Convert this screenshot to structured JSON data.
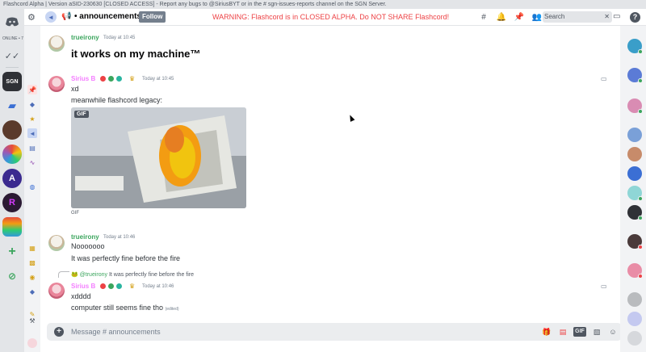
{
  "window": {
    "title": "Flashcord Alpha | Version aSID-230630 [CLOSED ACCESS] - Report any bugs to @SiriusBYT or in the # sgn-issues-reports channel on the SGN Server."
  },
  "server_rail": {
    "online_label": "ONLINE • 7"
  },
  "topbar": {
    "channel_name": "announcements",
    "follow_label": "Follow",
    "warning": "WARNING: Flashcord is in CLOSED ALPHA. Do NOT SHARE Flashcord!",
    "search_placeholder": "Search"
  },
  "messages": [
    {
      "author": "trueirony",
      "timestamp": "Today at 10:45",
      "text": "it works on my machine™"
    },
    {
      "author": "Sirius B",
      "timestamp": "Today at 10:45",
      "lines": [
        "xd",
        "meanwhile flashcord legacy:"
      ],
      "gif_tag": "GIF",
      "gif_caption": "GIF"
    },
    {
      "author": "trueirony",
      "timestamp": "Today at 10:46",
      "lines": [
        "Nooooooo",
        "It was perfectly fine before the fire"
      ]
    },
    {
      "reply_to": "@trueirony",
      "reply_excerpt": "It was perfectly fine before the fire",
      "author": "Sirius B",
      "timestamp": "Today at 10:46",
      "lines": [
        "xdddd",
        "computer still seems fine tho"
      ],
      "edited_label": "(edited)"
    }
  ],
  "composer": {
    "placeholder": "Message # announcements",
    "gif_label": "GIF"
  },
  "colors": {
    "warning": "#ed4245",
    "trueirony": "#3ba55d",
    "sirius": "#f47fff",
    "follow_button": "#747f8d"
  }
}
